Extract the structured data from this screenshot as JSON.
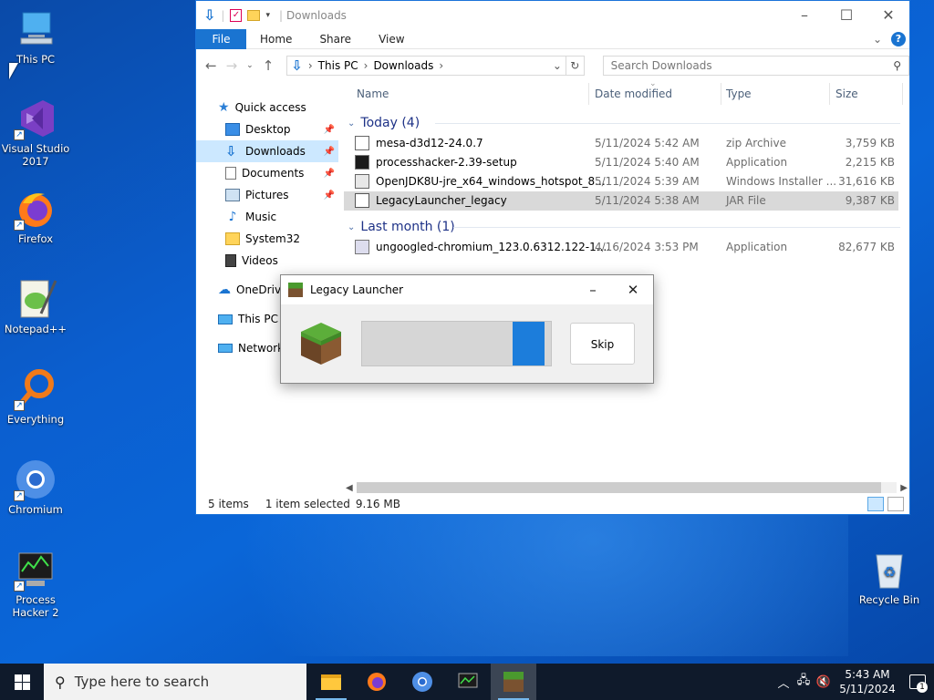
{
  "desktop": {
    "icons": [
      {
        "label": "This PC",
        "icon": "this-pc-icon"
      },
      {
        "label": "Visual Studio 2017",
        "icon": "visual-studio-icon"
      },
      {
        "label": "Firefox",
        "icon": "firefox-icon"
      },
      {
        "label": "Notepad++",
        "icon": "notepadpp-icon"
      },
      {
        "label": "Everything",
        "icon": "everything-icon"
      },
      {
        "label": "Chromium",
        "icon": "chromium-icon"
      },
      {
        "label": "Process Hacker 2",
        "icon": "process-hacker-icon"
      },
      {
        "label": "Recycle Bin",
        "icon": "recycle-bin-icon"
      }
    ]
  },
  "explorer": {
    "title": "Downloads",
    "ribbon": {
      "file": "File",
      "tabs": [
        "Home",
        "Share",
        "View"
      ]
    },
    "address": {
      "parts": [
        "This PC",
        "Downloads"
      ]
    },
    "search_placeholder": "Search Downloads",
    "nav": [
      {
        "label": "Quick access",
        "icon": "star-icon"
      },
      {
        "label": "Desktop",
        "icon": "desktop-folder-icon",
        "pinned": true
      },
      {
        "label": "Downloads",
        "icon": "download-folder-icon",
        "pinned": true,
        "selected": true
      },
      {
        "label": "Documents",
        "icon": "documents-folder-icon",
        "pinned": true
      },
      {
        "label": "Pictures",
        "icon": "pictures-folder-icon",
        "pinned": true
      },
      {
        "label": "Music",
        "icon": "music-folder-icon"
      },
      {
        "label": "System32",
        "icon": "folder-icon"
      },
      {
        "label": "Videos",
        "icon": "videos-folder-icon"
      },
      {
        "label": "OneDrive",
        "icon": "onedrive-icon"
      },
      {
        "label": "This PC",
        "icon": "this-pc-icon"
      },
      {
        "label": "Network",
        "icon": "network-icon"
      }
    ],
    "columns": {
      "name": "Name",
      "date": "Date modified",
      "type": "Type",
      "size": "Size"
    },
    "groups": [
      {
        "label": "Today (4)",
        "files": [
          {
            "name": "mesa-d3d12-24.0.7",
            "date": "5/11/2024 5:42 AM",
            "type": "zip Archive",
            "size": "3,759 KB",
            "icon": "zip-icon"
          },
          {
            "name": "processhacker-2.39-setup",
            "date": "5/11/2024 5:40 AM",
            "type": "Application",
            "size": "2,215 KB",
            "icon": "app-icon"
          },
          {
            "name": "OpenJDK8U-jre_x64_windows_hotspot_8...",
            "date": "5/11/2024 5:39 AM",
            "type": "Windows Installer ...",
            "size": "31,616 KB",
            "icon": "msi-icon"
          },
          {
            "name": "LegacyLauncher_legacy",
            "date": "5/11/2024 5:38 AM",
            "type": "JAR File",
            "size": "9,387 KB",
            "icon": "jar-icon",
            "selected": true
          }
        ]
      },
      {
        "label": "Last month (1)",
        "files": [
          {
            "name": "ungoogled-chromium_123.0.6312.122-1....",
            "date": "4/16/2024 3:53 PM",
            "type": "Application",
            "size": "82,677 KB",
            "icon": "app-icon"
          }
        ]
      }
    ],
    "status": {
      "items": "5 items",
      "selection": "1 item selected",
      "size": "9.16 MB"
    }
  },
  "dialog": {
    "title": "Legacy Launcher",
    "skip_label": "Skip",
    "progress_marquee": true
  },
  "taskbar": {
    "search_placeholder": "Type here to search",
    "apps": [
      "file-explorer-icon",
      "firefox-icon",
      "chromium-icon",
      "process-hacker-icon",
      "minecraft-icon"
    ],
    "time": "5:43 AM",
    "date": "5/11/2024",
    "notifications": "1"
  },
  "colors": {
    "accent": "#1a74d1",
    "selection": "#cce8ff",
    "taskbar": "#0f1a2b",
    "progress": "#1c7ddb"
  }
}
